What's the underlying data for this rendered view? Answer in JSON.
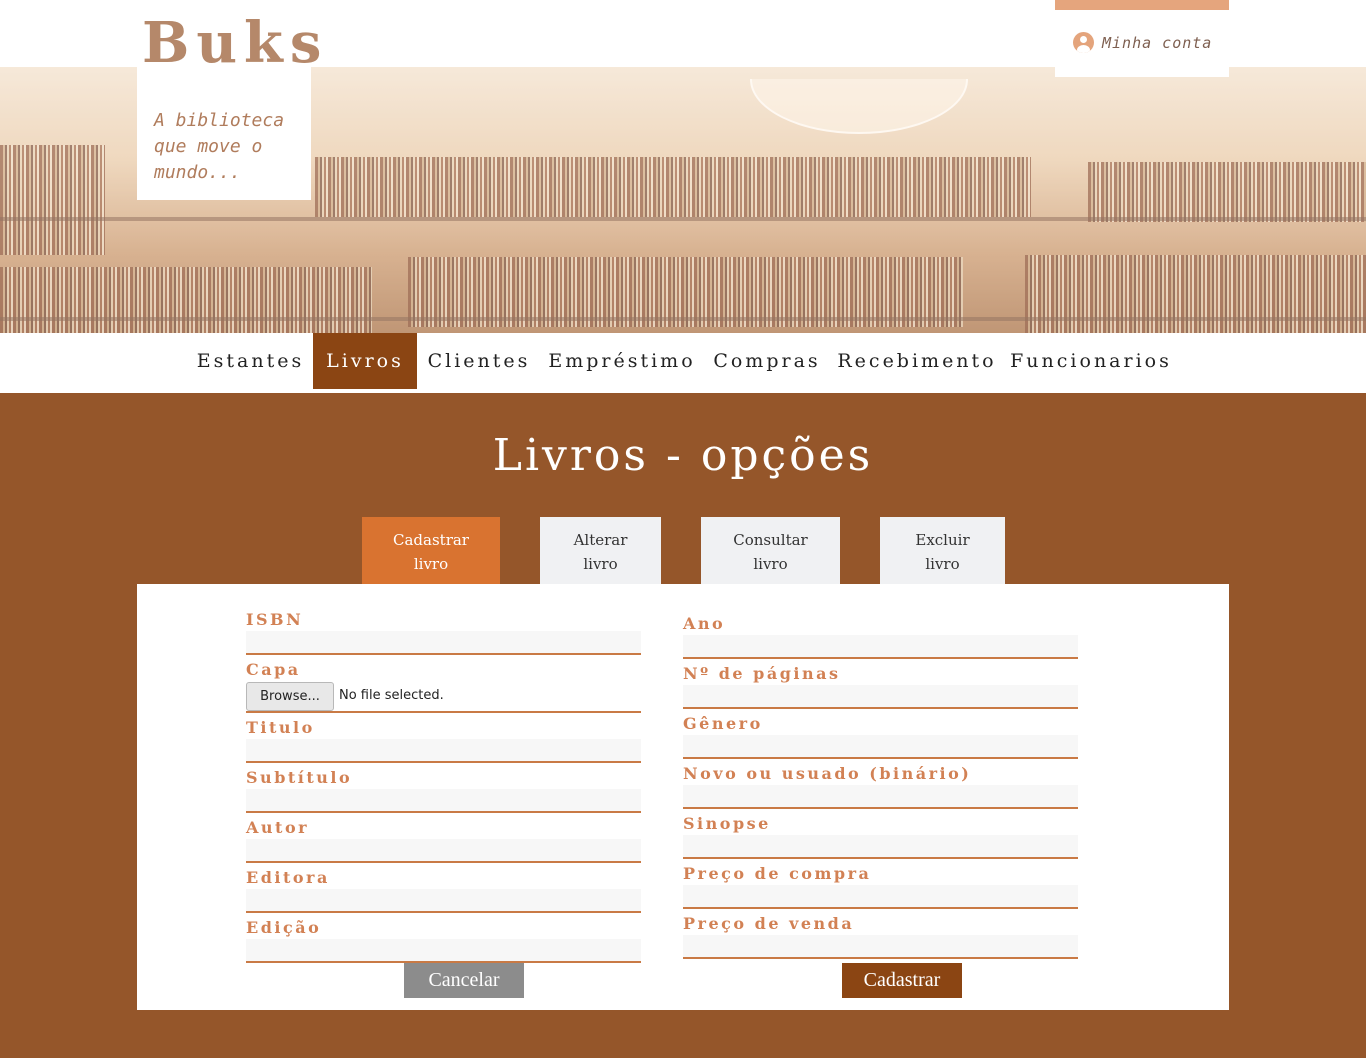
{
  "brand": {
    "logo": "Buks",
    "tagline": "A biblioteca que move o mundo..."
  },
  "account": {
    "label": "Minha conta",
    "icon": "user-circle-icon",
    "accent_color": "#e5a57d"
  },
  "nav": {
    "items": [
      {
        "label": "Estantes"
      },
      {
        "label": "Livros"
      },
      {
        "label": "Clientes"
      },
      {
        "label": "Empréstimo"
      },
      {
        "label": "Compras"
      },
      {
        "label": "Recebimento"
      },
      {
        "label": "Funcionarios"
      }
    ],
    "active": "Livros",
    "active_color": "#8b4513"
  },
  "page": {
    "title": "Livros - opções",
    "background": "#95562a"
  },
  "tabs": {
    "items": [
      {
        "line1": "Cadastrar",
        "line2": "livro"
      },
      {
        "line1": "Alterar",
        "line2": "livro"
      },
      {
        "line1": "Consultar",
        "line2": "livro"
      },
      {
        "line1": "Excluir",
        "line2": "livro"
      }
    ],
    "active": "Cadastrar livro",
    "active_color": "#d97330"
  },
  "form": {
    "left_fields": {
      "isbn": {
        "label": "ISBN",
        "value": ""
      },
      "capa": {
        "label": "Capa",
        "browse_label": "Browse...",
        "file_status": "No file selected."
      },
      "titulo": {
        "label": "Titulo",
        "value": ""
      },
      "subtitulo": {
        "label": "Subtítulo",
        "value": ""
      },
      "autor": {
        "label": "Autor",
        "value": ""
      },
      "editora": {
        "label": "Editora",
        "value": ""
      },
      "edicao": {
        "label": "Edição",
        "value": ""
      }
    },
    "right_fields": {
      "ano": {
        "label": "Ano",
        "value": ""
      },
      "paginas": {
        "label": "Nº de páginas",
        "value": ""
      },
      "genero": {
        "label": "Gênero",
        "value": ""
      },
      "novo_usado": {
        "label": "Novo ou usuado (binário)",
        "value": ""
      },
      "sinopse": {
        "label": "Sinopse",
        "value": ""
      },
      "preco_compra": {
        "label": "Preço de compra",
        "value": ""
      },
      "preco_venda": {
        "label": "Preço de venda",
        "value": ""
      }
    },
    "label_color": "#d28154",
    "underline_color": "#c97a45"
  },
  "buttons": {
    "cancel": {
      "label": "Cancelar",
      "color": "#8c8c8c"
    },
    "submit": {
      "label": "Cadastrar",
      "color": "#8b4513"
    }
  }
}
